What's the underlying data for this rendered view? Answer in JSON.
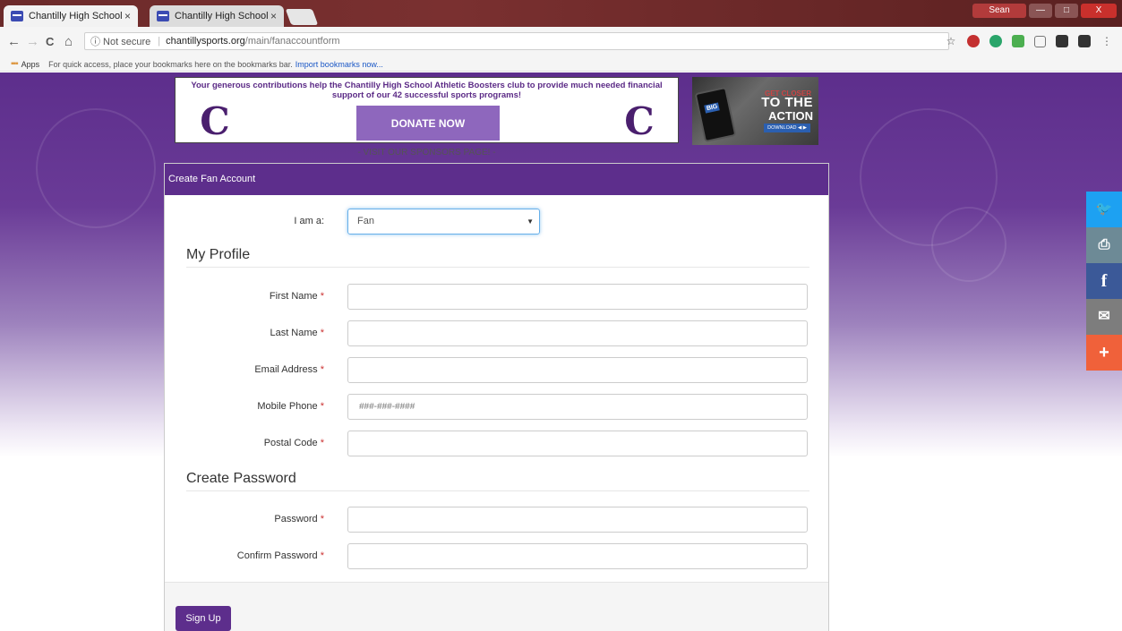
{
  "browser": {
    "tabs": [
      {
        "title": "Chantilly High School",
        "active": true
      },
      {
        "title": "Chantilly High School",
        "active": false
      }
    ],
    "tab_close": "×",
    "window_user": "Sean",
    "window_min": "—",
    "window_max": "□",
    "window_close": "X",
    "nav": {
      "back": "←",
      "forward": "→",
      "reload": "C",
      "home": "⌂"
    },
    "address": {
      "security": "ⓘ Not secure",
      "separator": "|",
      "domain": "chantillysports.org",
      "path": "/main/fanaccountform"
    },
    "bookmark_star": "☆",
    "extensions_menu": "⋮",
    "bookmarks_bar": {
      "apps_label": "Apps",
      "hint": "For quick access, place your bookmarks here on the bookmarks bar.",
      "link": "Import bookmarks now..."
    }
  },
  "banner": {
    "text": "Your generous contributions help the Chantilly High School Athletic Boosters club to provide much needed financial support of our 42 successful sports programs!",
    "logo_letter": "C",
    "donate_label": "DONATE NOW",
    "sponsors_link": "- VISIT OUR SPONSORS PAGE! -"
  },
  "ad": {
    "logo": "BIG",
    "line1": "GET CLOSER",
    "line2": "TO THE",
    "line3": "ACTION",
    "download": "DOWNLOAD ◀ ▶"
  },
  "form": {
    "header": "Create Fan Account",
    "role_label": "I am a:",
    "role_value": "Fan",
    "role_caret": "▼",
    "profile_title": "My Profile",
    "fields": {
      "first_name": {
        "label": "First Name",
        "value": ""
      },
      "last_name": {
        "label": "Last Name",
        "value": ""
      },
      "email": {
        "label": "Email Address",
        "value": ""
      },
      "mobile": {
        "label": "Mobile Phone",
        "placeholder": "###-###-####"
      },
      "postal": {
        "label": "Postal Code",
        "value": ""
      }
    },
    "required_mark": "*",
    "password_title": "Create Password",
    "password_fields": {
      "password": {
        "label": "Password"
      },
      "confirm": {
        "label": "Confirm Password"
      }
    },
    "submit_label": "Sign Up"
  },
  "share": {
    "twitter": "🐦",
    "print": "⎙",
    "facebook": "f",
    "email": "✉",
    "more": "+"
  },
  "colors": {
    "brand_purple": "#5d2e8c",
    "donate_purple": "#8e67bd",
    "twitter": "#1da1f2",
    "print": "#6d8a96",
    "facebook": "#3b5998",
    "email": "#7d7d7d",
    "more": "#f0613a"
  }
}
